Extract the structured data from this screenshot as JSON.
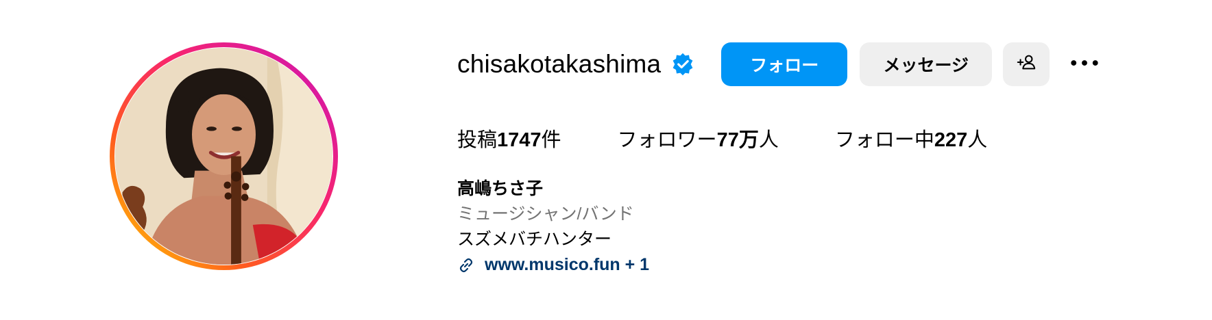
{
  "profile": {
    "username": "chisakotakashima",
    "verified": true,
    "avatar_ring_colors": [
      "#c913b9",
      "#f8266d",
      "#ff5b1f",
      "#ffd600"
    ]
  },
  "actions": {
    "follow_label": "フォロー",
    "message_label": "メッセージ",
    "suggest_icon": "add-person-icon",
    "more_icon": "more-options-icon",
    "follow_color": "#0095f6"
  },
  "stats": {
    "posts_prefix": "投稿",
    "posts_value": "1747",
    "posts_suffix": "件",
    "followers_prefix": "フォロワー",
    "followers_value": "77万",
    "followers_suffix": "人",
    "following_prefix": "フォロー中",
    "following_value": "227",
    "following_suffix": "人"
  },
  "bio": {
    "full_name": "高嶋ちさ子",
    "category": "ミュージシャン/バンド",
    "text": "スズメバチハンター",
    "link_text": "www.musico.fun + 1",
    "link_color": "#00376b"
  }
}
